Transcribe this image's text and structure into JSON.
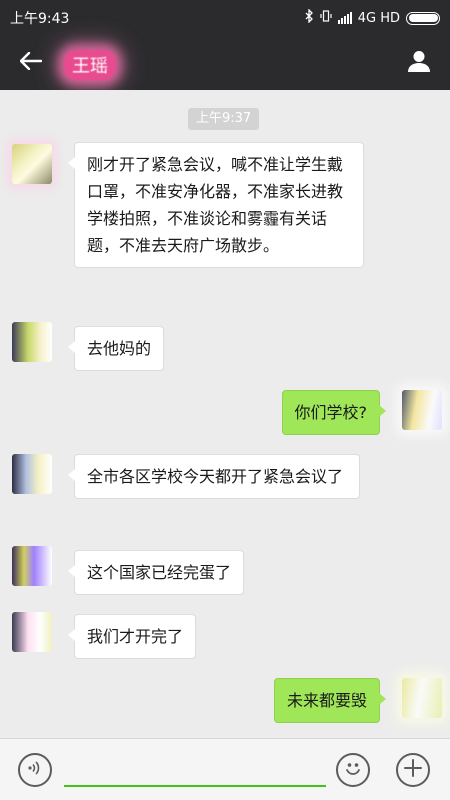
{
  "status_bar": {
    "time": "上午9:43",
    "network": "4G HD",
    "icons": [
      "bluetooth-icon",
      "vibrate-icon",
      "signal-icon",
      "battery-icon"
    ]
  },
  "header": {
    "title": "王瑶",
    "icons": [
      "back-arrow-icon",
      "profile-icon"
    ]
  },
  "chat": {
    "timestamp": "上午9:37",
    "messages": [
      {
        "side": "in",
        "text": "刚才开了紧急会议，喊不准让学生戴口罩，不准安净化器，不准家长进教学楼拍照，不准谈论和雾霾有关话题，不准去天府广场散步。"
      },
      {
        "side": "in",
        "text": "去他妈的"
      },
      {
        "side": "out",
        "text": "你们学校?"
      },
      {
        "side": "in",
        "text": " 全市各区学校今天都开了紧急会议了"
      },
      {
        "side": "in",
        "text": "这个国家已经完蛋了"
      },
      {
        "side": "in",
        "text": "我们才开完了"
      },
      {
        "side": "out",
        "text": "未来都要毁"
      }
    ]
  },
  "input_bar": {
    "value": "",
    "icons": [
      "voice-icon",
      "emoji-icon",
      "plus-icon"
    ]
  },
  "colors": {
    "header_bg": "#2b2b2d",
    "chat_bg": "#ececec",
    "outgoing_bubble": "#9fe658",
    "incoming_bubble": "#ffffff",
    "input_underline": "#45c01a"
  }
}
